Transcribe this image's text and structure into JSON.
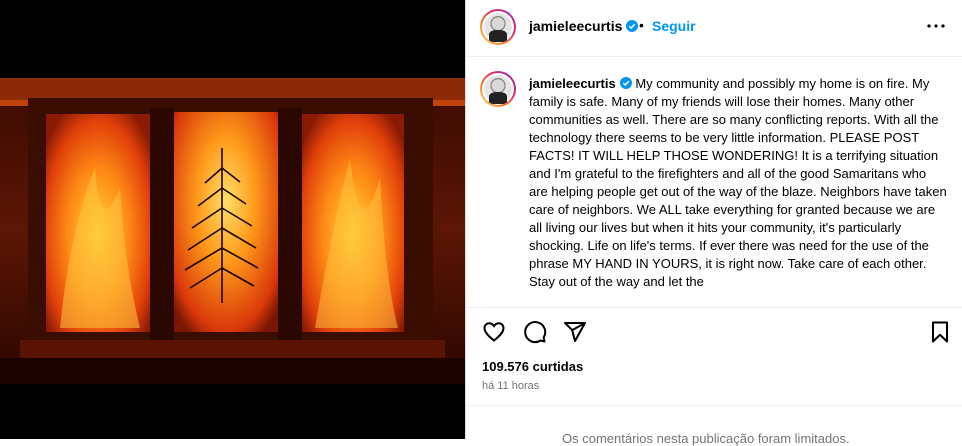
{
  "post": {
    "username": "jamieleecurtis",
    "separator": "•",
    "follow_label": "Seguir",
    "caption": "My community and possibly my home is on fire. My family is safe. Many of my friends will lose their homes. Many other communities as well. There are so many conflicting reports. With all the technology there seems to be very little information. PLEASE POST FACTS! IT WILL HELP THOSE WONDERING! It is a terrifying situation and I'm grateful to the firefighters and all of the good Samaritans who are helping people get out of the way of the blaze. Neighbors have taken care of neighbors. We ALL take everything for granted because we are all living our lives but when it hits your community, it's particularly shocking. Life on life's terms. If ever there was need for the use of the phrase MY HAND IN YOURS, it is right now. Take care of each other. Stay out of the way and let the",
    "likes": "109.576 curtidas",
    "time": "há 11 horas",
    "comments_limited": "Os comentários nesta publicação foram limitados."
  },
  "icons": {
    "verified": "verified-badge-icon",
    "more": "more-options-icon",
    "like": "heart-icon",
    "comment": "comment-icon",
    "share": "share-icon",
    "save": "bookmark-icon"
  },
  "colors": {
    "link_blue": "#0095f6",
    "verified_blue": "#0095f6",
    "muted": "#737373"
  }
}
